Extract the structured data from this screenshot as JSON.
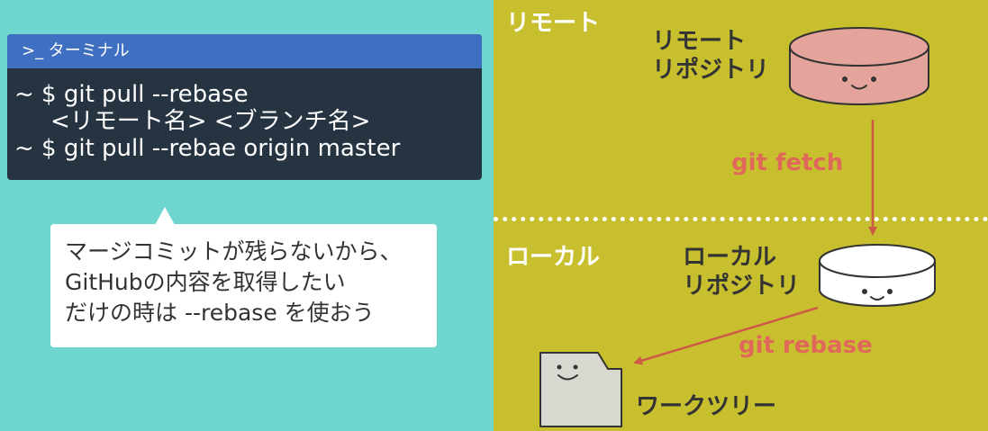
{
  "terminal": {
    "title": ">_ ターミナル",
    "lines": [
      "~ $ git pull --rebase",
      "<リモート名> <ブランチ名>",
      "~ $ git pull --rebae origin master"
    ]
  },
  "callout": {
    "lines": [
      "マージコミットが残らないから、",
      "GitHubの内容を取得したい",
      "だけの時は --rebase を使おう"
    ]
  },
  "zones": {
    "remote": "リモート",
    "local": "ローカル"
  },
  "remote_repo": {
    "line1": "リモート",
    "line2": "リポジトリ",
    "color": "#e5a49b"
  },
  "local_repo": {
    "line1": "ローカル",
    "line2": "リポジトリ",
    "color": "#ffffff"
  },
  "worktree": {
    "label": "ワークツリー",
    "color": "#d8d8d0"
  },
  "commands": {
    "fetch": "git fetch",
    "rebase": "git rebase"
  },
  "colors": {
    "left_bg": "#6ed6cf",
    "right_bg": "#c8bf2e",
    "terminal_bg": "#263442",
    "terminal_title_bg": "#3f6fc0",
    "arrow": "#cc5a45",
    "command_text": "#e0685a"
  }
}
